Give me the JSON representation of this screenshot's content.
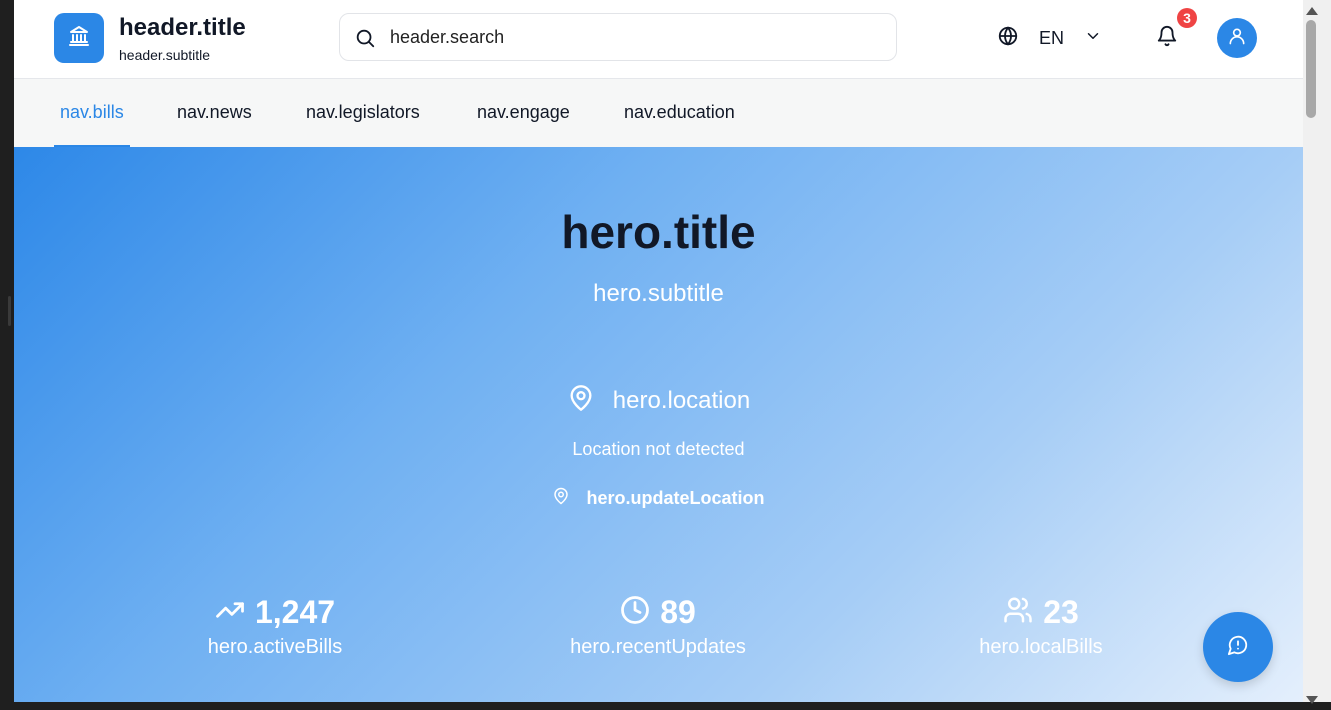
{
  "header": {
    "title": "header.title",
    "subtitle": "header.subtitle",
    "search_placeholder": "header.search",
    "language": "EN",
    "notification_count": "3"
  },
  "nav": {
    "items": [
      {
        "label": "nav.bills",
        "active": true
      },
      {
        "label": "nav.news"
      },
      {
        "label": "nav.legislators"
      },
      {
        "label": "nav.engage"
      },
      {
        "label": "nav.education"
      }
    ]
  },
  "hero": {
    "title": "hero.title",
    "subtitle": "hero.subtitle",
    "location_label": "hero.location",
    "location_status": "Location not detected",
    "update_location": "hero.updateLocation",
    "stats": [
      {
        "icon": "trending-up-icon",
        "value": "1,247",
        "label": "hero.activeBills"
      },
      {
        "icon": "clock-icon",
        "value": "89",
        "label": "hero.recentUpdates"
      },
      {
        "icon": "users-icon",
        "value": "23",
        "label": "hero.localBills"
      }
    ]
  },
  "colors": {
    "accent": "#2b87e6",
    "badge": "#ef4444"
  }
}
